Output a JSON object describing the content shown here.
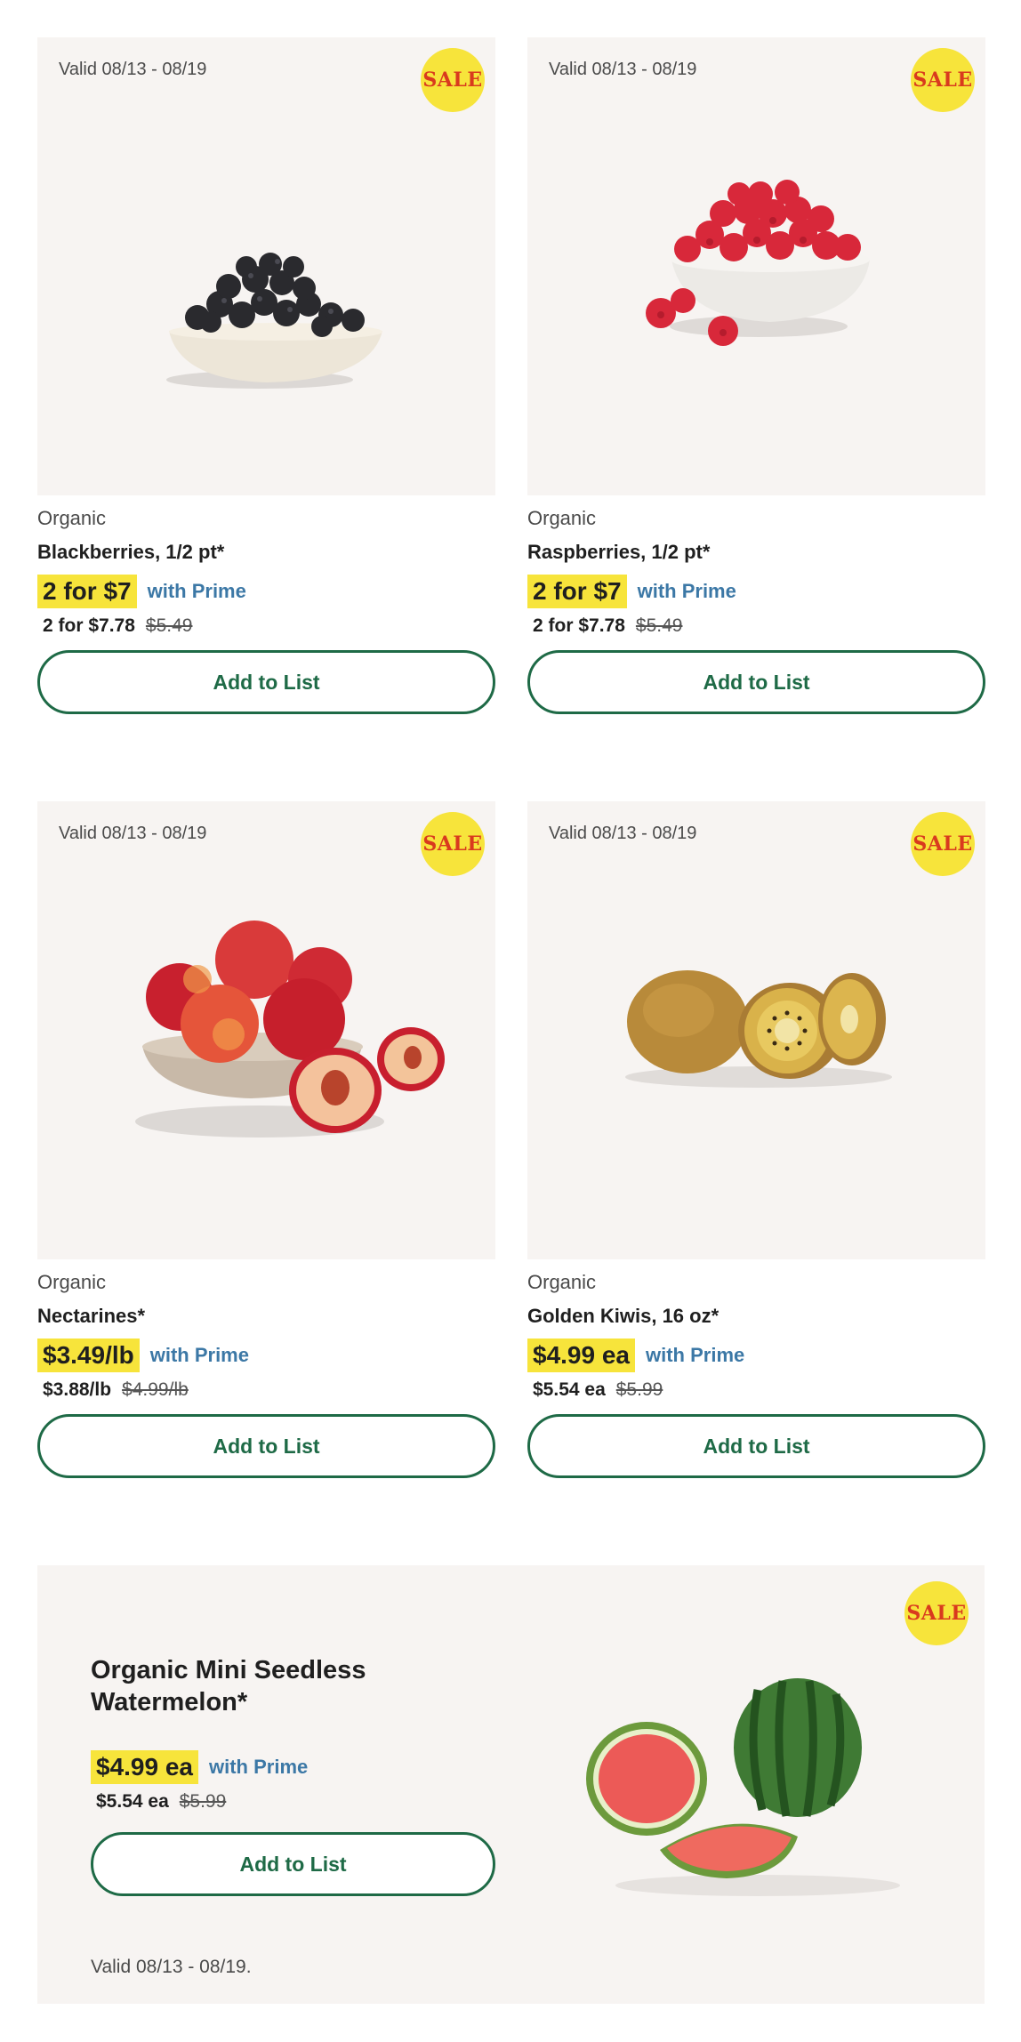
{
  "products": [
    {
      "valid": "Valid 08/13 - 08/19",
      "sale": "SALE",
      "brand": "Organic",
      "name": "Blackberries, 1/2 pt*",
      "promo_price": "2 for $7",
      "prime": "with Prime",
      "regular_price": "2 for $7.78",
      "original_price": "$5.49",
      "button": "Add to List",
      "image": "blackberries-in-bowl"
    },
    {
      "valid": "Valid 08/13 - 08/19",
      "sale": "SALE",
      "brand": "Organic",
      "name": "Raspberries, 1/2 pt*",
      "promo_price": "2 for $7",
      "prime": "with Prime",
      "regular_price": "2 for $7.78",
      "original_price": "$5.49",
      "button": "Add to List",
      "image": "raspberries-in-bowl"
    },
    {
      "valid": "Valid 08/13 - 08/19",
      "sale": "SALE",
      "brand": "Organic",
      "name": "Nectarines*",
      "promo_price": "$3.49/lb",
      "prime": "with Prime",
      "regular_price": "$3.88/lb",
      "original_price": "$4.99/lb",
      "button": "Add to List",
      "image": "nectarines-in-bowl"
    },
    {
      "valid": "Valid 08/13 - 08/19",
      "sale": "SALE",
      "brand": "Organic",
      "name": "Golden Kiwis, 16 oz*",
      "promo_price": "$4.99 ea",
      "prime": "with Prime",
      "regular_price": "$5.54 ea",
      "original_price": "$5.99",
      "button": "Add to List",
      "image": "golden-kiwis"
    }
  ],
  "banner": {
    "sale": "SALE",
    "title": "Organic Mini Seedless Watermelon*",
    "promo_price": "$4.99 ea",
    "prime": "with Prime",
    "regular_price": "$5.54 ea",
    "original_price": "$5.99",
    "button": "Add to List",
    "valid": "Valid 08/13 - 08/19.",
    "image": "mini-watermelon"
  },
  "colors": {
    "sale_badge": "#f7e43b",
    "sale_text": "#d93a1e",
    "promo_highlight": "#f7e43b",
    "prime_text": "#3c78a6",
    "button_green": "#1e6a46",
    "card_background": "#f7f4f2"
  }
}
